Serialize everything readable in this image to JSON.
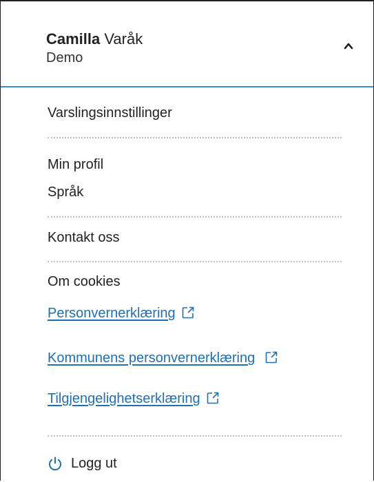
{
  "user": {
    "first_name": "Camilla",
    "last_name": "Varåk",
    "organization": "Demo"
  },
  "menu": {
    "notification_settings": "Varslingsinnstillinger",
    "my_profile": "Min profil",
    "language": "Språk",
    "contact_us": "Kontakt oss",
    "about_cookies": "Om cookies",
    "privacy_statement": "Personvernerklæring",
    "municipality_privacy_statement": "Kommunens personvernerklæring",
    "accessibility_statement": "Tilgjengelighetserklæring",
    "log_out": "Logg ut"
  },
  "icons": {
    "chevron": "chevron-up-icon",
    "external_link": "external-link-icon",
    "power": "power-icon"
  },
  "colors": {
    "accent": "#3c8dc5",
    "link": "#1f6fb5",
    "divider": "#bfbfbf"
  }
}
